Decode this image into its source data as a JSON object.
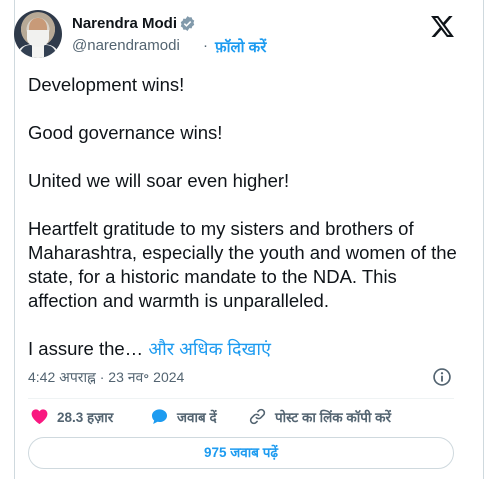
{
  "author": {
    "name": "Narendra Modi",
    "handle": "@narendramodi",
    "separator": "·",
    "follow_label": "फ़ॉलो करें"
  },
  "tweet": {
    "paragraphs": [
      "Development wins!",
      "Good governance wins!",
      "United we will soar even higher!",
      "Heartfelt gratitude to my sisters and brothers of Maharashtra, especially the youth and women of the state, for a historic mandate to the NDA. This affection and warmth is unparalleled."
    ],
    "truncated_text": "I assure the…",
    "show_more_label": "और अधिक दिखाएं",
    "timestamp": "4:42 अपराह्न · 23 नव॰ 2024"
  },
  "actions": {
    "likes_label": "28.3 हज़ार",
    "reply_label": "जवाब दें",
    "copy_link_label": "पोस्ट का लिंक कॉपी करें"
  },
  "read_replies_label": "975 जवाब पढ़ें",
  "colors": {
    "accent": "#1d9bf0",
    "like": "#f91880",
    "verified": "#829aab",
    "text": "#0f1419",
    "muted": "#536471"
  },
  "icons": [
    "verified-badge-icon",
    "x-logo-icon",
    "info-icon",
    "heart-icon",
    "reply-bubble-icon",
    "link-icon"
  ]
}
